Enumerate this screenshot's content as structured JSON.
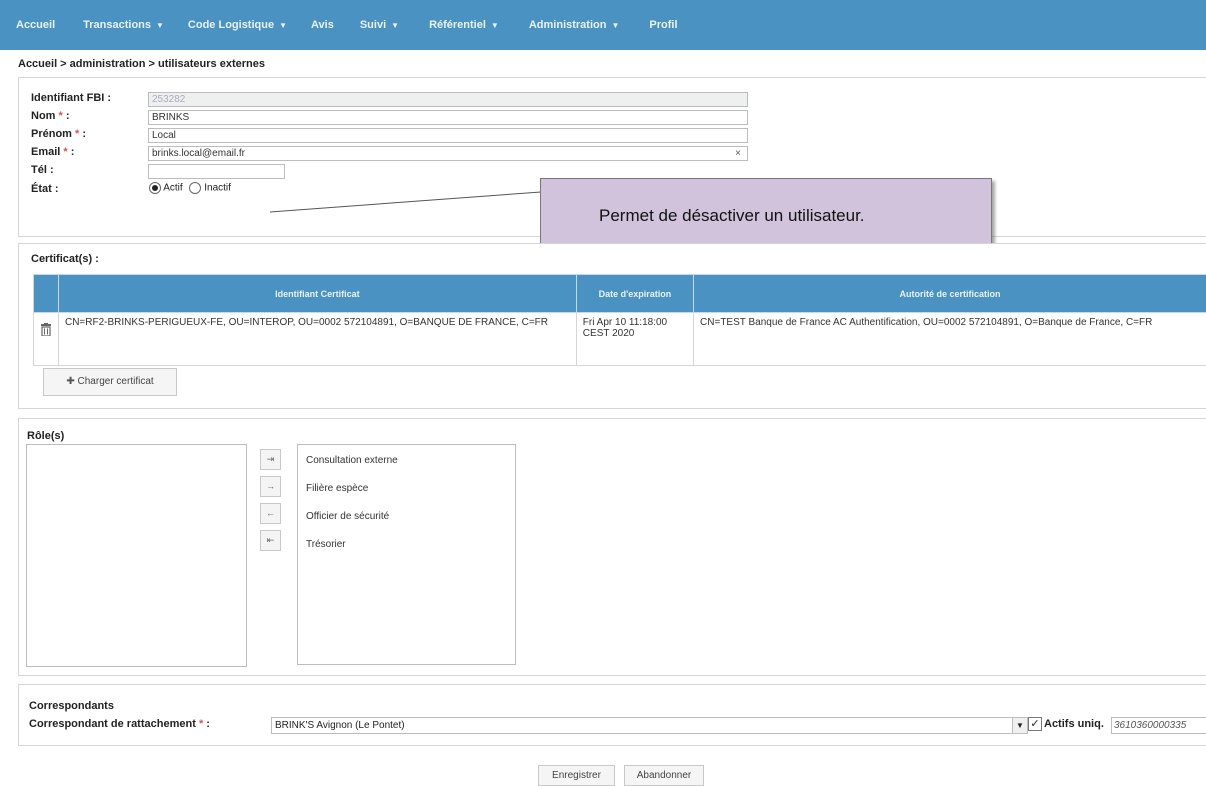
{
  "nav": {
    "items": [
      {
        "label": "Accueil",
        "dropdown": false
      },
      {
        "label": "Transactions",
        "dropdown": true
      },
      {
        "label": "Code Logistique",
        "dropdown": true
      },
      {
        "label": "Avis",
        "dropdown": false
      },
      {
        "label": "Suivi",
        "dropdown": true
      },
      {
        "label": "Référentiel",
        "dropdown": true
      },
      {
        "label": "Administration",
        "dropdown": true
      },
      {
        "label": "Profil",
        "dropdown": false
      }
    ]
  },
  "breadcrumb": "Accueil > administration > utilisateurs externes",
  "form": {
    "fbi_label": "Identifiant FBI :",
    "fbi_value": "253282",
    "nom_label": "Nom",
    "nom_value": "BRINKS",
    "prenom_label": "Prénom",
    "prenom_value": "Local",
    "email_label": "Email",
    "email_value": "brinks.local@email.fr",
    "tel_label": "Tél :",
    "tel_value": "",
    "etat_label": "État :",
    "etat_actif": "Actif",
    "etat_inactif": "Inactif",
    "required_mark": "*",
    "colon": " :"
  },
  "callout": {
    "text": "Permet de désactiver un utilisateur."
  },
  "certificats": {
    "title": "Certificat(s) :",
    "headers": [
      "Identifiant Certificat",
      "Date d'expiration",
      "Autorité de certification"
    ],
    "rows": [
      {
        "identifiant": "CN=RF2-BRINKS-PERIGUEUX-FE, OU=INTEROP, OU=0002 572104891, O=BANQUE DE FRANCE, C=FR",
        "date": "Fri Apr 10 11:18:00 CEST 2020",
        "autorite": "CN=TEST Banque de France AC Authentification, OU=0002 572104891, O=Banque de France, C=FR"
      }
    ],
    "load_button": "Charger certificat"
  },
  "roles": {
    "title": "Rôle(s)",
    "available": [],
    "assigned": [
      "Consultation externe",
      "Filière espèce",
      "Officier de sécurité",
      "Trésorier"
    ]
  },
  "correspondants": {
    "title": "Correspondants",
    "rattachement_label": "Correspondant de rattachement",
    "rattachement_value": "BRINK'S Avignon (Le Pontet)",
    "actifs_label": "Actifs uniq.",
    "actifs_checked": true,
    "code": "3610360000335"
  },
  "actions": {
    "save": "Enregistrer",
    "cancel": "Abandonner"
  },
  "colors": {
    "nav_bg": "#4a92c2",
    "callout_bg": "#d1c3dc",
    "required": "#d9534f"
  }
}
